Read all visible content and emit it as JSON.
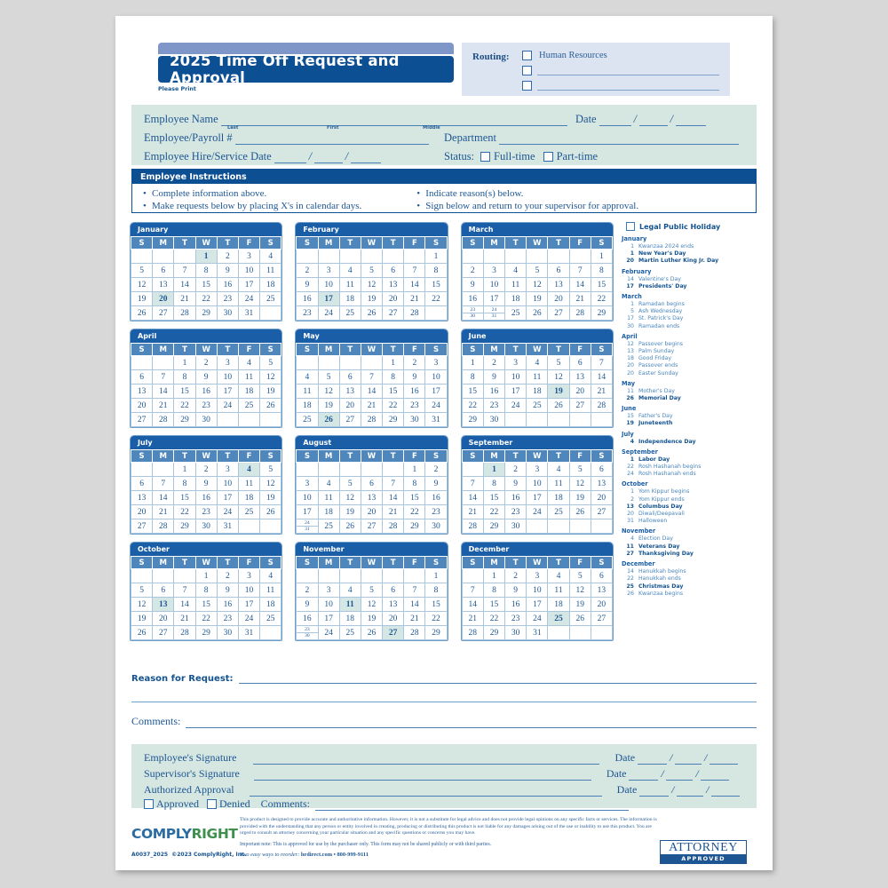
{
  "title": "2025 Time Off Request and Approval",
  "please_print": "Please Print",
  "routing": {
    "label": "Routing:",
    "items": [
      "Human Resources",
      "",
      ""
    ]
  },
  "employee_info": {
    "employee_name_label": "Employee Name",
    "sub_last": "Last",
    "sub_first": "First",
    "sub_middle": "Middle",
    "date_label": "Date",
    "payroll_label": "Employee/Payroll #",
    "department_label": "Department",
    "hire_label": "Employee Hire/Service Date",
    "status_label": "Status:",
    "status_fulltime": "Full-time",
    "status_parttime": "Part-time"
  },
  "instructions": {
    "header": "Employee Instructions",
    "left": [
      "Complete information above.",
      "Make requests below by placing X's in calendar days."
    ],
    "right": [
      "Indicate reason(s) below.",
      "Sign below and return to your supervisor for approval."
    ]
  },
  "weekdays": [
    "S",
    "M",
    "T",
    "W",
    "T",
    "F",
    "S"
  ],
  "calendars": [
    {
      "name": "January",
      "weeks": [
        [
          "",
          "",
          "",
          "1",
          "2",
          "3",
          "4"
        ],
        [
          "5",
          "6",
          "7",
          "8",
          "9",
          "10",
          "11"
        ],
        [
          "12",
          "13",
          "14",
          "15",
          "16",
          "17",
          "18"
        ],
        [
          "19",
          "20",
          "21",
          "22",
          "23",
          "24",
          "25"
        ],
        [
          "26",
          "27",
          "28",
          "29",
          "30",
          "31",
          ""
        ]
      ],
      "highlight": [
        "1",
        "20"
      ]
    },
    {
      "name": "February",
      "weeks": [
        [
          "",
          "",
          "",
          "",
          "",
          "",
          "1"
        ],
        [
          "2",
          "3",
          "4",
          "5",
          "6",
          "7",
          "8"
        ],
        [
          "9",
          "10",
          "11",
          "12",
          "13",
          "14",
          "15"
        ],
        [
          "16",
          "17",
          "18",
          "19",
          "20",
          "21",
          "22"
        ],
        [
          "23",
          "24",
          "25",
          "26",
          "27",
          "28",
          ""
        ]
      ],
      "highlight": [
        "17"
      ]
    },
    {
      "name": "March",
      "weeks": [
        [
          "",
          "",
          "",
          "",
          "",
          "",
          "1"
        ],
        [
          "2",
          "3",
          "4",
          "5",
          "6",
          "7",
          "8"
        ],
        [
          "9",
          "10",
          "11",
          "12",
          "13",
          "14",
          "15"
        ],
        [
          "16",
          "17",
          "18",
          "19",
          "20",
          "21",
          "22"
        ],
        [
          "23/30",
          "24/31",
          "25",
          "26",
          "27",
          "28",
          "29"
        ]
      ],
      "highlight": []
    },
    {
      "name": "April",
      "weeks": [
        [
          "",
          "",
          "1",
          "2",
          "3",
          "4",
          "5"
        ],
        [
          "6",
          "7",
          "8",
          "9",
          "10",
          "11",
          "12"
        ],
        [
          "13",
          "14",
          "15",
          "16",
          "17",
          "18",
          "19"
        ],
        [
          "20",
          "21",
          "22",
          "23",
          "24",
          "25",
          "26"
        ],
        [
          "27",
          "28",
          "29",
          "30",
          "",
          "",
          ""
        ]
      ],
      "highlight": []
    },
    {
      "name": "May",
      "weeks": [
        [
          "",
          "",
          "",
          "",
          "1",
          "2",
          "3"
        ],
        [
          "4",
          "5",
          "6",
          "7",
          "8",
          "9",
          "10"
        ],
        [
          "11",
          "12",
          "13",
          "14",
          "15",
          "16",
          "17"
        ],
        [
          "18",
          "19",
          "20",
          "21",
          "22",
          "23",
          "24"
        ],
        [
          "25",
          "26",
          "27",
          "28",
          "29",
          "30",
          "31"
        ]
      ],
      "highlight": [
        "26"
      ]
    },
    {
      "name": "June",
      "weeks": [
        [
          "1",
          "2",
          "3",
          "4",
          "5",
          "6",
          "7"
        ],
        [
          "8",
          "9",
          "10",
          "11",
          "12",
          "13",
          "14"
        ],
        [
          "15",
          "16",
          "17",
          "18",
          "19",
          "20",
          "21"
        ],
        [
          "22",
          "23",
          "24",
          "25",
          "26",
          "27",
          "28"
        ],
        [
          "29",
          "30",
          "",
          "",
          "",
          "",
          ""
        ]
      ],
      "highlight": [
        "19"
      ]
    },
    {
      "name": "July",
      "weeks": [
        [
          "",
          "",
          "1",
          "2",
          "3",
          "4",
          "5"
        ],
        [
          "6",
          "7",
          "8",
          "9",
          "10",
          "11",
          "12"
        ],
        [
          "13",
          "14",
          "15",
          "16",
          "17",
          "18",
          "19"
        ],
        [
          "20",
          "21",
          "22",
          "23",
          "24",
          "25",
          "26"
        ],
        [
          "27",
          "28",
          "29",
          "30",
          "31",
          "",
          ""
        ]
      ],
      "highlight": [
        "4"
      ]
    },
    {
      "name": "August",
      "weeks": [
        [
          "",
          "",
          "",
          "",
          "",
          "1",
          "2"
        ],
        [
          "3",
          "4",
          "5",
          "6",
          "7",
          "8",
          "9"
        ],
        [
          "10",
          "11",
          "12",
          "13",
          "14",
          "15",
          "16"
        ],
        [
          "17",
          "18",
          "19",
          "20",
          "21",
          "22",
          "23"
        ],
        [
          "24/31",
          "25",
          "26",
          "27",
          "28",
          "29",
          "30"
        ]
      ],
      "highlight": []
    },
    {
      "name": "September",
      "weeks": [
        [
          "",
          "1",
          "2",
          "3",
          "4",
          "5",
          "6"
        ],
        [
          "7",
          "8",
          "9",
          "10",
          "11",
          "12",
          "13"
        ],
        [
          "14",
          "15",
          "16",
          "17",
          "18",
          "19",
          "20"
        ],
        [
          "21",
          "22",
          "23",
          "24",
          "25",
          "26",
          "27"
        ],
        [
          "28",
          "29",
          "30",
          "",
          "",
          "",
          ""
        ]
      ],
      "highlight": [
        "1"
      ]
    },
    {
      "name": "October",
      "weeks": [
        [
          "",
          "",
          "",
          "1",
          "2",
          "3",
          "4"
        ],
        [
          "5",
          "6",
          "7",
          "8",
          "9",
          "10",
          "11"
        ],
        [
          "12",
          "13",
          "14",
          "15",
          "16",
          "17",
          "18"
        ],
        [
          "19",
          "20",
          "21",
          "22",
          "23",
          "24",
          "25"
        ],
        [
          "26",
          "27",
          "28",
          "29",
          "30",
          "31",
          ""
        ]
      ],
      "highlight": [
        "13"
      ]
    },
    {
      "name": "November",
      "weeks": [
        [
          "",
          "",
          "",
          "",
          "",
          "",
          "1"
        ],
        [
          "2",
          "3",
          "4",
          "5",
          "6",
          "7",
          "8"
        ],
        [
          "9",
          "10",
          "11",
          "12",
          "13",
          "14",
          "15"
        ],
        [
          "16",
          "17",
          "18",
          "19",
          "20",
          "21",
          "22"
        ],
        [
          "23/30",
          "24",
          "25",
          "26",
          "27",
          "28",
          "29"
        ]
      ],
      "highlight": [
        "11",
        "27"
      ]
    },
    {
      "name": "December",
      "weeks": [
        [
          "",
          "1",
          "2",
          "3",
          "4",
          "5",
          "6"
        ],
        [
          "7",
          "8",
          "9",
          "10",
          "11",
          "12",
          "13"
        ],
        [
          "14",
          "15",
          "16",
          "17",
          "18",
          "19",
          "20"
        ],
        [
          "21",
          "22",
          "23",
          "24",
          "25",
          "26",
          "27"
        ],
        [
          "28",
          "29",
          "30",
          "31",
          "",
          "",
          ""
        ]
      ],
      "highlight": [
        "25"
      ]
    }
  ],
  "legend": {
    "header": "Legal Public Holiday",
    "months": [
      {
        "name": "January",
        "entries": [
          {
            "day": "1",
            "name": "Kwanzaa 2024 ends",
            "bold": false
          },
          {
            "day": "1",
            "name": "New Year's Day",
            "bold": true
          },
          {
            "day": "20",
            "name": "Martin Luther King Jr. Day",
            "bold": true
          }
        ]
      },
      {
        "name": "February",
        "entries": [
          {
            "day": "14",
            "name": "Valentine's Day",
            "bold": false
          },
          {
            "day": "17",
            "name": "Presidents' Day",
            "bold": true
          }
        ]
      },
      {
        "name": "March",
        "entries": [
          {
            "day": "1",
            "name": "Ramadan begins",
            "bold": false
          },
          {
            "day": "5",
            "name": "Ash Wednesday",
            "bold": false
          },
          {
            "day": "17",
            "name": "St. Patrick's Day",
            "bold": false
          },
          {
            "day": "30",
            "name": "Ramadan ends",
            "bold": false
          }
        ]
      },
      {
        "name": "April",
        "entries": [
          {
            "day": "12",
            "name": "Passover begins",
            "bold": false
          },
          {
            "day": "13",
            "name": "Palm Sunday",
            "bold": false
          },
          {
            "day": "18",
            "name": "Good Friday",
            "bold": false
          },
          {
            "day": "20",
            "name": "Passover ends",
            "bold": false
          },
          {
            "day": "20",
            "name": "Easter Sunday",
            "bold": false
          }
        ]
      },
      {
        "name": "May",
        "entries": [
          {
            "day": "11",
            "name": "Mother's Day",
            "bold": false
          },
          {
            "day": "26",
            "name": "Memorial Day",
            "bold": true
          }
        ]
      },
      {
        "name": "June",
        "entries": [
          {
            "day": "15",
            "name": "Father's Day",
            "bold": false
          },
          {
            "day": "19",
            "name": "Juneteenth",
            "bold": true
          }
        ]
      },
      {
        "name": "July",
        "entries": [
          {
            "day": "4",
            "name": "Independence Day",
            "bold": true
          }
        ]
      },
      {
        "name": "September",
        "entries": [
          {
            "day": "1",
            "name": "Labor Day",
            "bold": true
          },
          {
            "day": "22",
            "name": "Rosh Hashanah begins",
            "bold": false
          },
          {
            "day": "24",
            "name": "Rosh Hashanah ends",
            "bold": false
          }
        ]
      },
      {
        "name": "October",
        "entries": [
          {
            "day": "1",
            "name": "Yom Kippur begins",
            "bold": false
          },
          {
            "day": "2",
            "name": "Yom Kippur ends",
            "bold": false
          },
          {
            "day": "13",
            "name": "Columbus Day",
            "bold": true
          },
          {
            "day": "20",
            "name": "Diwali/Deepavali",
            "bold": false
          },
          {
            "day": "31",
            "name": "Halloween",
            "bold": false
          }
        ]
      },
      {
        "name": "November",
        "entries": [
          {
            "day": "4",
            "name": "Election Day",
            "bold": false
          },
          {
            "day": "11",
            "name": "Veterans Day",
            "bold": true
          },
          {
            "day": "27",
            "name": "Thanksgiving Day",
            "bold": true
          }
        ]
      },
      {
        "name": "December",
        "entries": [
          {
            "day": "14",
            "name": "Hanukkah begins",
            "bold": false
          },
          {
            "day": "22",
            "name": "Hanukkah ends",
            "bold": false
          },
          {
            "day": "25",
            "name": "Christmas Day",
            "bold": true
          },
          {
            "day": "26",
            "name": "Kwanzaa begins",
            "bold": false
          }
        ]
      }
    ]
  },
  "reason_label": "Reason for Request:",
  "comments_label": "Comments:",
  "signature": {
    "employee": "Employee's Signature",
    "supervisor": "Supervisor's Signature",
    "authorized": "Authorized Approval",
    "date_label": "Date",
    "approved": "Approved",
    "denied": "Denied",
    "comments": "Comments:"
  },
  "footer": {
    "brand_part1": "COMPLY",
    "brand_part2": "RIGHT",
    "sku": "A0037_2025",
    "copyright": "©2023 ComplyRight, Inc.",
    "disclaimer": "This product is designed to provide accurate and authoritative information. However, it is not a substitute for legal advice and does not provide legal opinions on any specific facts or services. The information is provided with the understanding that any person or entity involved in creating, producing or distributing this product is not liable for any damages arising out of the use or inability to use this product. You are urged to consult an attorney concerning your particular situation and any specific questions or concerns you may have.",
    "important_note": "Important note: This is approved for use by the purchaser only. This form may not be shared publicly or with third parties.",
    "reorder_prefix": "Two easy ways to reorder:",
    "reorder_contact": "hrdirect.com • 800-999-9111",
    "attorney_line1": "ATTORNEY",
    "attorney_line2": "APPROVED"
  },
  "colors": {
    "dark_blue": "#0d4f93",
    "header_blue": "#1b5ea8",
    "weekday_blue": "#4f87bd",
    "mint": "#d6e6e0",
    "routing_bg": "#dde4f1",
    "highlight": "#d4e7e4"
  }
}
